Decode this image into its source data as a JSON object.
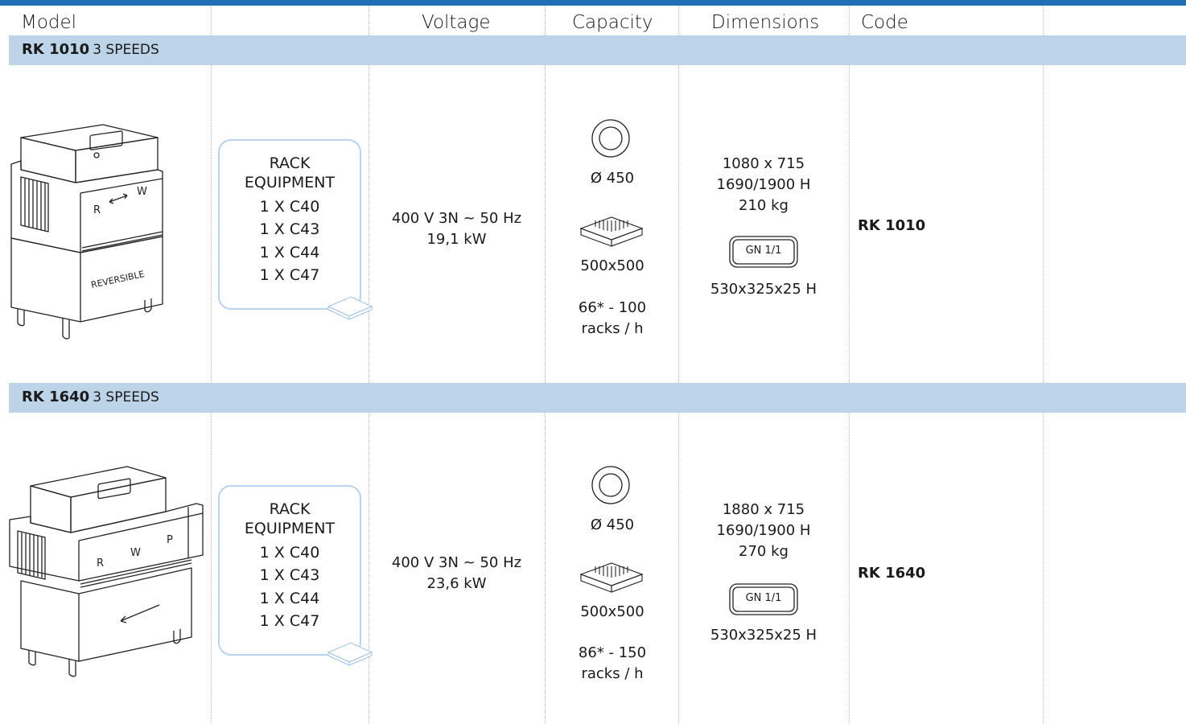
{
  "headers": {
    "model": "Model",
    "voltage": "Voltage",
    "capacity": "Capacity",
    "dimensions": "Dimensions",
    "code": "Code"
  },
  "products": [
    {
      "model": "RK 1010",
      "speeds": "3 SPEEDS",
      "machine_labels": {
        "r": "R",
        "w": "W",
        "side": "REVERSIBLE"
      },
      "rack": [
        "RACK",
        "EQUIPMENT",
        "1 X C40",
        "1 X C43",
        "1 X C44",
        "1 X C47"
      ],
      "voltage": [
        "400 V 3N ~ 50 Hz",
        "19,1 kW"
      ],
      "plate": "Ø 450",
      "basket": "500x500",
      "racks_per_hour": [
        "66* - 100",
        "racks / h"
      ],
      "dimensions": [
        "1080 x 715",
        "1690/1900 H",
        "210 kg"
      ],
      "gn_label": "GN 1/1",
      "gn_size": "530x325x25 H",
      "code": "RK 1010"
    },
    {
      "model": "RK 1640",
      "speeds": "3 SPEEDS",
      "machine_labels": {
        "r": "R",
        "w": "W",
        "p": "P"
      },
      "rack": [
        "RACK",
        "EQUIPMENT",
        "1 X C40",
        "1 X C43",
        "1 X C44",
        "1 X C47"
      ],
      "voltage": [
        "400 V 3N ~ 50 Hz",
        "23,6 kW"
      ],
      "plate": "Ø 450",
      "basket": "500x500",
      "racks_per_hour": [
        "86* - 150",
        "racks / h"
      ],
      "dimensions": [
        "1880 x 715",
        "1690/1900 H",
        "270 kg"
      ],
      "gn_label": "GN 1/1",
      "gn_size": "530x325x25 H",
      "code": "RK 1640"
    }
  ],
  "colors": {
    "accent_bar": "#1f6fb4",
    "section_band": "#bcd3e8",
    "rack_box_border": "#b9d3ee"
  }
}
